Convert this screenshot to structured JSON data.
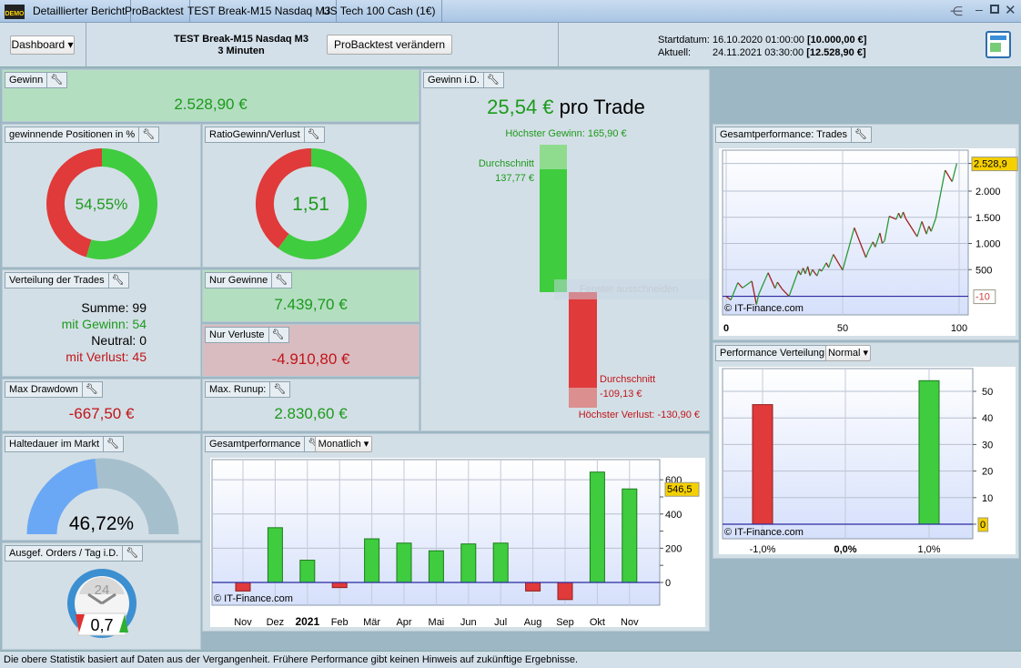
{
  "titlebar": {
    "logo": "DEMO",
    "tabs": [
      "Detaillierter Bericht",
      "ProBacktest",
      "TEST Break-M15 Nasdaq M3",
      "US Tech 100 Cash (1€)"
    ]
  },
  "header": {
    "dashboard_label": "Dashboard",
    "strategy_name": "TEST Break-M15 Nasdaq M3",
    "timeframe": "3 Minuten",
    "change_button": "ProBacktest verändern",
    "start_label": "Startdatum:",
    "start_value": "16.10.2020 01:00:00",
    "start_capital": "[10.000,00 €]",
    "current_label": "Aktuell:",
    "current_value": "24.11.2021 03:30:00",
    "current_capital": "[12.528,90 €]"
  },
  "panels": {
    "gewinn": {
      "title": "Gewinn",
      "value": "2.528,90 €"
    },
    "win_pct": {
      "title": "gewinnende Positionen in %",
      "value": "54,55%",
      "fraction": 0.5455
    },
    "ratio": {
      "title": "RatioGewinn/Verlust",
      "value": "1,51",
      "fraction": 0.6016
    },
    "verteilung": {
      "title": "Verteilung der Trades",
      "sum": "Summe: 99",
      "wins": "mit Gewinn: 54",
      "neutral": "Neutral: 0",
      "losses": "mit Verlust: 45"
    },
    "nur_gewinne": {
      "title": "Nur Gewinne",
      "value": "7.439,70 €"
    },
    "nur_verluste": {
      "title": "Nur Verluste",
      "value": "-4.910,80 €"
    },
    "drawdown": {
      "title": "Max Drawdown",
      "value": "-667,50 €"
    },
    "runup": {
      "title": "Max. Runup:",
      "value": "2.830,60 €"
    },
    "haltedauer": {
      "title": "Haltedauer im Markt",
      "value": "46,72%",
      "fraction": 0.4672
    },
    "orders": {
      "title": "Ausgef. Orders / Tag i.D.",
      "value": "0,7",
      "clock_label": "24"
    },
    "gewinn_id": {
      "title": "Gewinn i.D.",
      "value": "25,54 €",
      "suffix": "pro Trade",
      "max_gain": "Höchster Gewinn: 165,90 €",
      "avg_gain_label": "Durchschnitt",
      "avg_gain": "137,77 €",
      "avg_loss_label": "Durchschnitt",
      "avg_loss": "-109,13 €",
      "max_loss": "Höchster Verlust: -130,90 €",
      "tooltip": "Fenster ausschneiden"
    },
    "monthly": {
      "title": "Gesamtperformance",
      "mode": "Monatlich",
      "copyright": "© IT-Finance.com"
    },
    "trades": {
      "title": "Gesamtperformance: Trades",
      "copyright": "© IT-Finance.com"
    },
    "distribution": {
      "title": "Performance Verteilung",
      "mode": "Normal",
      "copyright": "© IT-Finance.com"
    }
  },
  "footer": "Die obere Statistik basiert auf Daten aus der Vergangenheit. Frühere Performance gibt keinen Hinweis auf zukünftige Ergebnisse.",
  "chart_data": [
    {
      "type": "bar",
      "title": "Gesamtperformance Monatlich",
      "categories": [
        "Nov",
        "Dez",
        "2021",
        "Feb",
        "Mär",
        "Apr",
        "Mai",
        "Jun",
        "Jul",
        "Aug",
        "Sep",
        "Okt",
        "Nov"
      ],
      "values": [
        -50,
        320,
        130,
        -30,
        255,
        230,
        185,
        225,
        230,
        -50,
        -100,
        645,
        546.5
      ],
      "yticks": [
        "0",
        "200",
        "400",
        "600"
      ],
      "ylim": [
        -133,
        718
      ],
      "last_label": "546,5"
    },
    {
      "type": "line",
      "title": "Gesamtperformance: Trades",
      "x": [
        0,
        2,
        5,
        7,
        11,
        13,
        14,
        18,
        21,
        22,
        24,
        27,
        31,
        32,
        33,
        34,
        35,
        36,
        37,
        39,
        40,
        41,
        43,
        44,
        46,
        50,
        55,
        60,
        61,
        63,
        64,
        66,
        67,
        68,
        70,
        73,
        74,
        75,
        76,
        77,
        82,
        84,
        86,
        87,
        88,
        90,
        94,
        97,
        99
      ],
      "y": [
        -10,
        -80,
        250,
        150,
        280,
        -170,
        30,
        440,
        140,
        260,
        130,
        -10,
        480,
        400,
        530,
        420,
        560,
        380,
        500,
        380,
        510,
        470,
        630,
        540,
        790,
        490,
        1300,
        730,
        850,
        1030,
        930,
        1200,
        1000,
        1050,
        1520,
        1460,
        1580,
        1480,
        1600,
        1480,
        1130,
        1420,
        1180,
        1330,
        1230,
        1480,
        2400,
        2180,
        2528.9
      ],
      "xticks": [
        "0",
        "50",
        "100"
      ],
      "yticks": [
        "500",
        "1.000",
        "1.500",
        "2.000"
      ],
      "last_label": "2.528,9",
      "baseline_label": "-10"
    },
    {
      "type": "bar",
      "title": "Performance Verteilung",
      "categories": [
        "-1,0%",
        "0,0%",
        "1,0%"
      ],
      "values": [
        45,
        0,
        54
      ],
      "yticks": [
        "0",
        "10",
        "20",
        "30",
        "40",
        "50"
      ],
      "last_label": "0"
    }
  ]
}
